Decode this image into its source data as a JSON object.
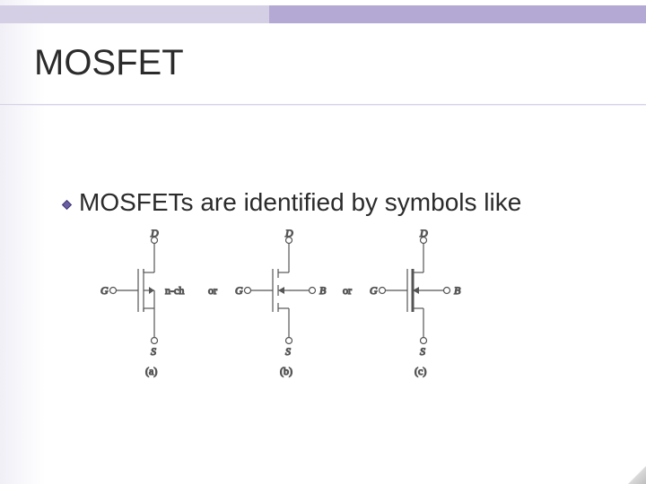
{
  "slide": {
    "title": "MOSFET",
    "bullet": "MOSFETs are identified by symbols like"
  },
  "circuits": {
    "labels": {
      "drain": "D",
      "source": "S",
      "gate": "G",
      "body": "B",
      "channel": "n-ch",
      "or": "or"
    },
    "captions": {
      "a": "(a)",
      "b": "(b)",
      "c": "(c)"
    }
  }
}
